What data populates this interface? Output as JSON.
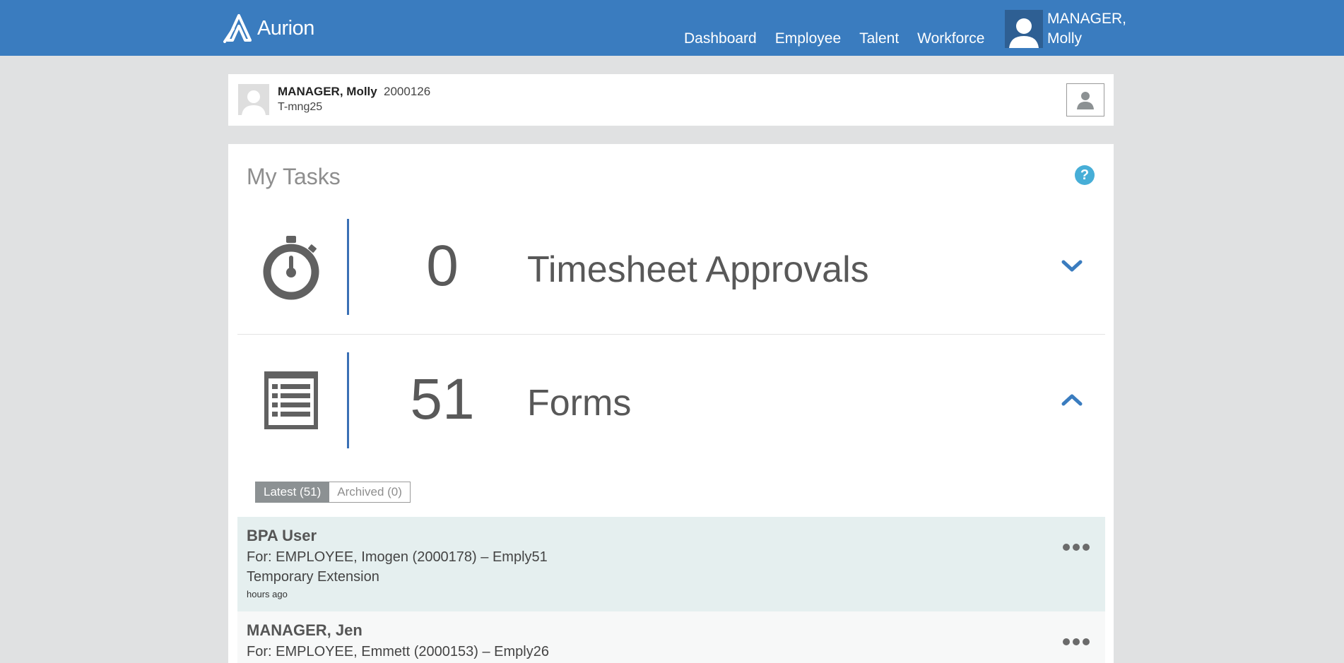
{
  "header": {
    "logo_text": "Aurion",
    "nav": [
      "Dashboard",
      "Employee",
      "Talent",
      "Workforce"
    ],
    "user_name_line1": "MANAGER,",
    "user_name_line2": "Molly",
    "background_color": "#3a7cbf"
  },
  "profile": {
    "name": "MANAGER, Molly",
    "employee_id": "2000126",
    "code": "T-mng25"
  },
  "tasks": {
    "title": "My Tasks",
    "help_label": "?",
    "rows": [
      {
        "icon": "stopwatch-icon",
        "count": "0",
        "label": "Timesheet Approvals",
        "expanded": false
      },
      {
        "icon": "form-list-icon",
        "count": "51",
        "label": "Forms",
        "expanded": true
      }
    ],
    "tabs": [
      {
        "label": "Latest (51)",
        "active": true
      },
      {
        "label": "Archived (0)",
        "active": false
      }
    ],
    "items": [
      {
        "title": "BPA User",
        "for": "For: EMPLOYEE, Imogen (2000178) – Emply51",
        "type": "Temporary Extension",
        "time": "hours ago"
      },
      {
        "title": "MANAGER, Jen",
        "for": "For: EMPLOYEE, Emmett (2000153) – Emply26",
        "type": "",
        "time": ""
      }
    ],
    "accent_color": "#3a70b5"
  }
}
